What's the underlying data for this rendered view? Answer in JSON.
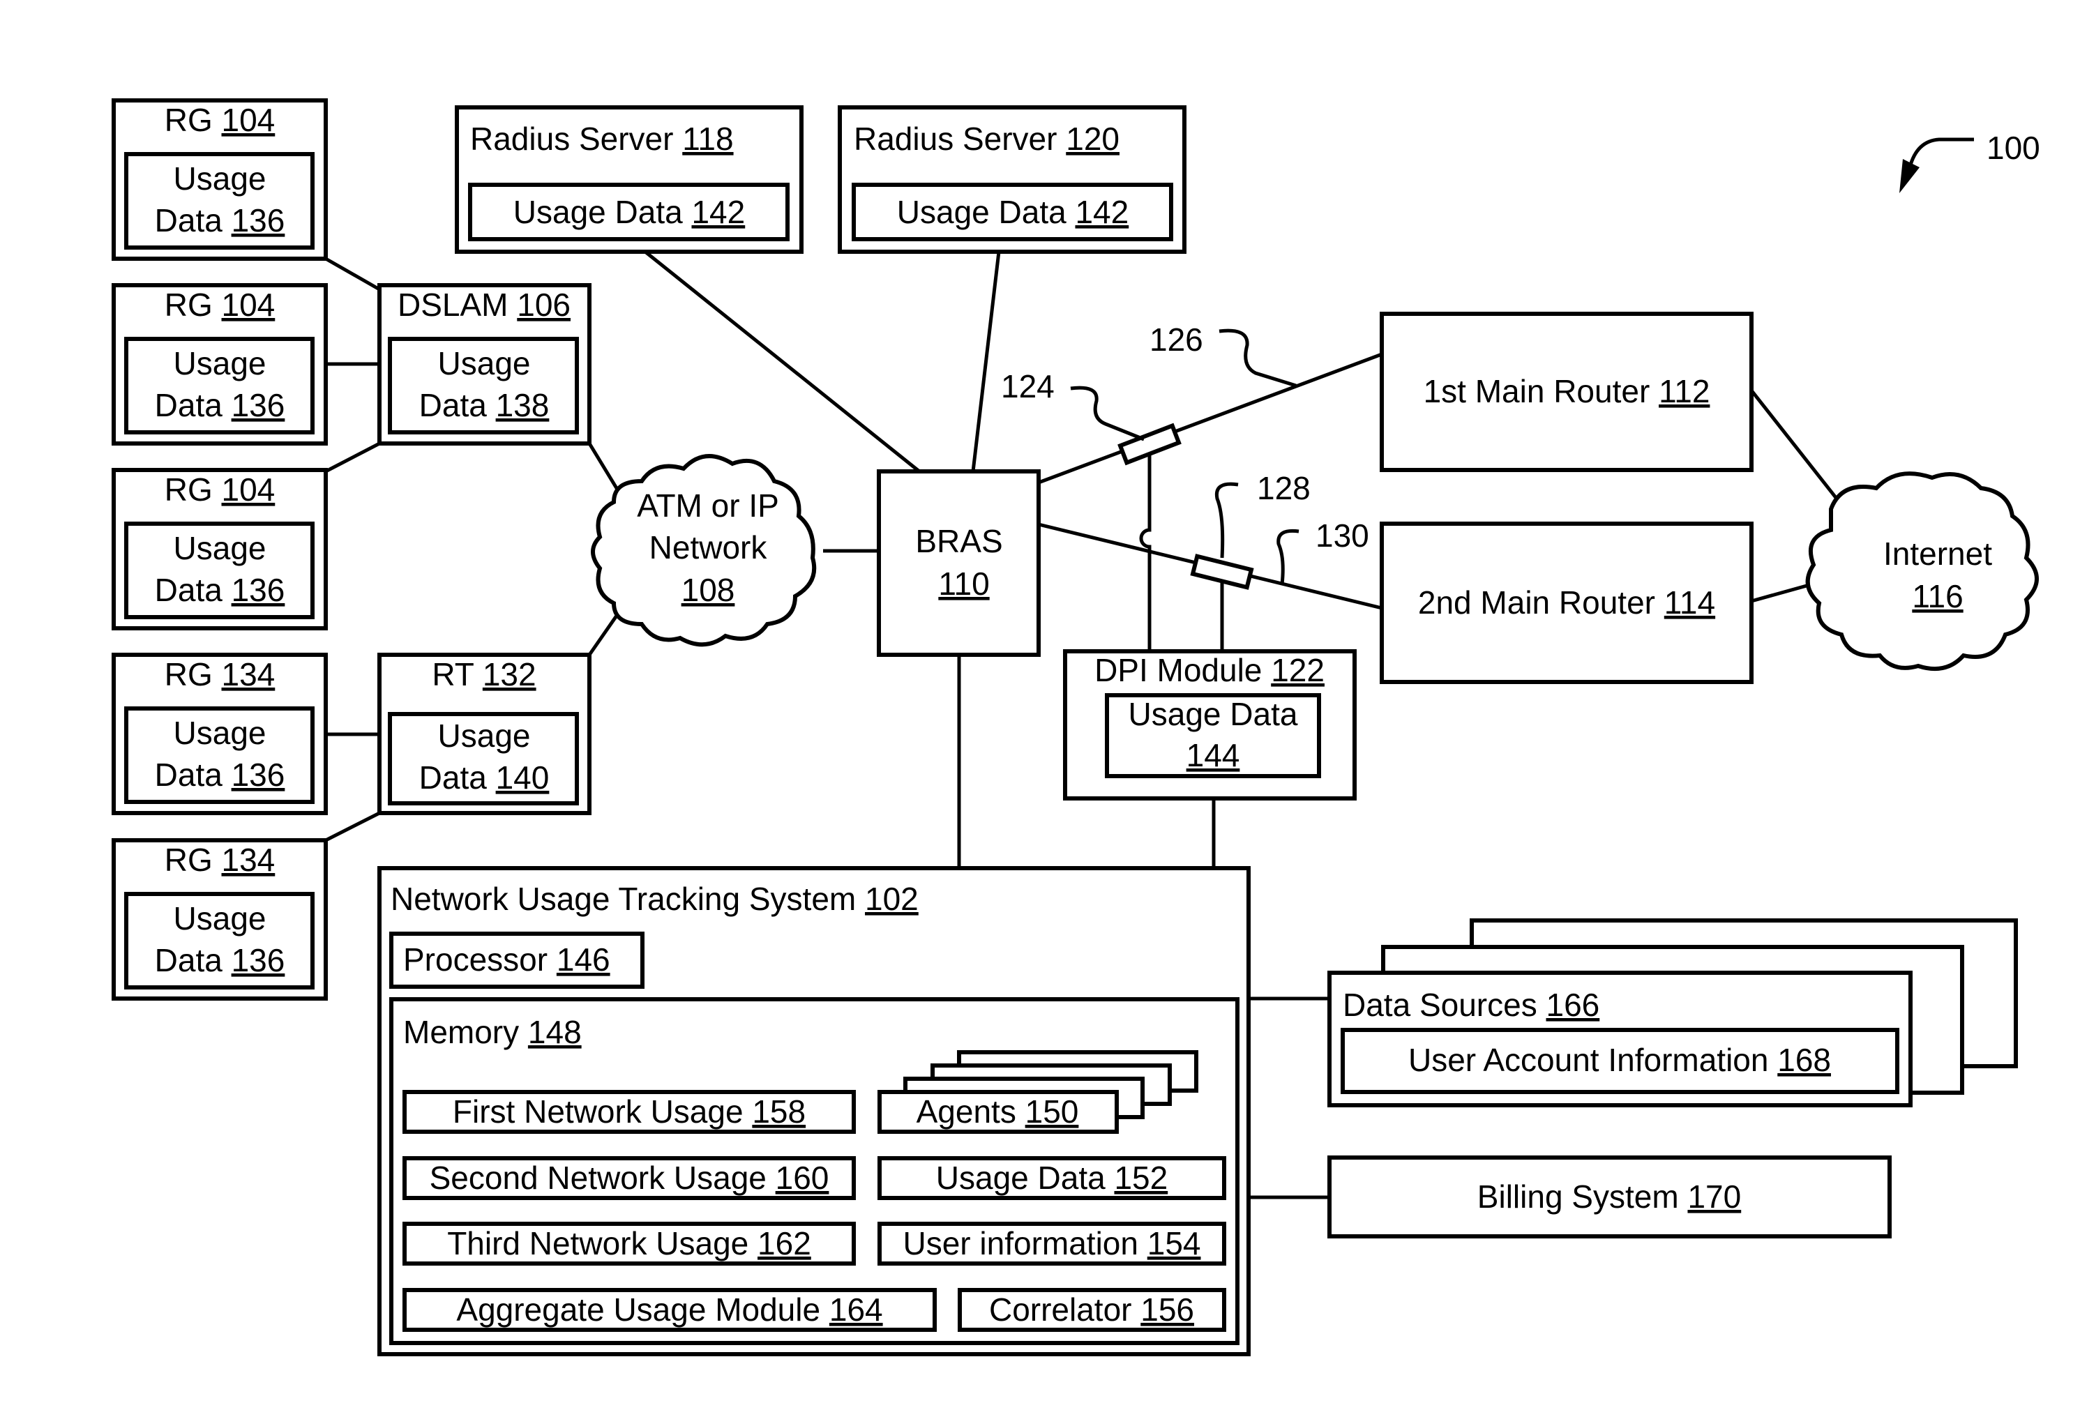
{
  "figure": {
    "figure_ref": "100",
    "nodes": {
      "rg1": {
        "label": "RG",
        "ref": "104",
        "inner": {
          "line1": "Usage",
          "line2": "Data",
          "ref": "136"
        }
      },
      "rg2": {
        "label": "RG",
        "ref": "104",
        "inner": {
          "line1": "Usage",
          "line2": "Data",
          "ref": "136"
        }
      },
      "rg3": {
        "label": "RG",
        "ref": "104",
        "inner": {
          "line1": "Usage",
          "line2": "Data",
          "ref": "136"
        }
      },
      "rg4": {
        "label": "RG",
        "ref": "134",
        "inner": {
          "line1": "Usage",
          "line2": "Data",
          "ref": "136"
        }
      },
      "rg5": {
        "label": "RG",
        "ref": "134",
        "inner": {
          "line1": "Usage",
          "line2": "Data",
          "ref": "136"
        }
      },
      "dslam": {
        "label": "DSLAM",
        "ref": "106",
        "inner": {
          "line1": "Usage",
          "line2": "Data",
          "ref": "138"
        }
      },
      "rt": {
        "label": "RT",
        "ref": "132",
        "inner": {
          "line1": "Usage",
          "line2": "Data",
          "ref": "140"
        }
      },
      "radius1": {
        "label": "Radius Server",
        "ref": "118",
        "inner": {
          "label": "Usage Data",
          "ref": "142"
        }
      },
      "radius2": {
        "label": "Radius Server",
        "ref": "120",
        "inner": {
          "label": "Usage Data",
          "ref": "142"
        }
      },
      "atm": {
        "line1": "ATM or IP",
        "line2": "Network",
        "ref": "108"
      },
      "bras": {
        "label": "BRAS",
        "ref": "110"
      },
      "router1": {
        "label": "1st Main Router",
        "ref": "112"
      },
      "router2": {
        "label": "2nd Main Router",
        "ref": "114"
      },
      "internet": {
        "label": "Internet",
        "ref": "116"
      },
      "dpi": {
        "label": "DPI Module",
        "ref": "122",
        "inner": {
          "line1": "Usage Data",
          "ref": "144"
        }
      },
      "nuts": {
        "label": "Network Usage Tracking System",
        "ref": "102",
        "processor": {
          "label": "Processor",
          "ref": "146"
        },
        "memory": {
          "label": "Memory",
          "ref": "148",
          "items": {
            "first": {
              "label": "First Network Usage",
              "ref": "158"
            },
            "second": {
              "label": "Second Network Usage",
              "ref": "160"
            },
            "third": {
              "label": "Third Network Usage",
              "ref": "162"
            },
            "aggregate": {
              "label": "Aggregate Usage Module",
              "ref": "164"
            },
            "agents": {
              "label": "Agents",
              "ref": "150"
            },
            "usage": {
              "label": "Usage Data",
              "ref": "152"
            },
            "userinfo": {
              "label": "User information",
              "ref": "154"
            },
            "correlator": {
              "label": "Correlator",
              "ref": "156"
            }
          }
        }
      },
      "datasources": {
        "label": "Data Sources",
        "ref": "166",
        "inner": {
          "label": "User Account Information",
          "ref": "168"
        }
      },
      "billing": {
        "label": "Billing System",
        "ref": "170"
      }
    },
    "callouts": {
      "c124": "124",
      "c126": "126",
      "c128": "128",
      "c130": "130"
    }
  }
}
